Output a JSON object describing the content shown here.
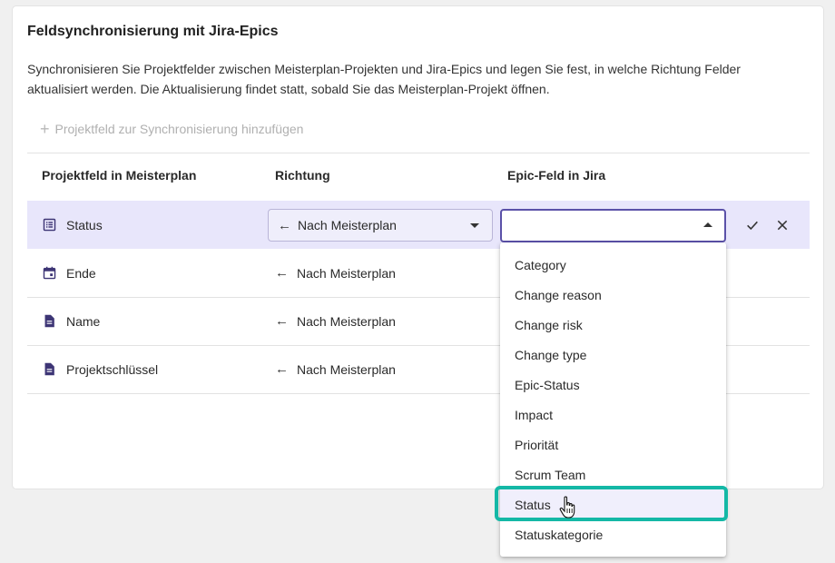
{
  "section": {
    "title": "Feldsynchronisierung mit Jira-Epics",
    "description": "Synchronisieren Sie Projektfelder zwischen Meisterplan-Projekten und Jira-Epics und legen Sie fest, in welche Richtung Felder aktualisiert werden. Die Aktualisierung findet statt, sobald Sie das Meisterplan-Projekt öffnen.",
    "add_label": "Projektfeld zur Synchronisierung hinzufügen"
  },
  "table": {
    "headers": {
      "project_field": "Projektfeld in Meisterplan",
      "direction": "Richtung",
      "epic_field": "Epic-Feld in Jira"
    },
    "rows": [
      {
        "field": "Status",
        "icon": "list-icon",
        "direction": "Nach Meisterplan",
        "editing": true
      },
      {
        "field": "Ende",
        "icon": "calendar-icon",
        "direction": "Nach Meisterplan"
      },
      {
        "field": "Name",
        "icon": "document-icon",
        "direction": "Nach Meisterplan"
      },
      {
        "field": "Projektschlüssel",
        "icon": "document-icon",
        "direction": "Nach Meisterplan"
      }
    ]
  },
  "epic_select": {
    "value": "",
    "options": [
      "Category",
      "Change reason",
      "Change risk",
      "Change type",
      "Epic-Status",
      "Impact",
      "Priorität",
      "Scrum Team",
      "Status",
      "Statuskategorie"
    ],
    "hovered": "Status"
  },
  "colors": {
    "accent": "#5b51a8",
    "selected_row": "#e8e6fb",
    "highlight": "#14b8a6"
  }
}
